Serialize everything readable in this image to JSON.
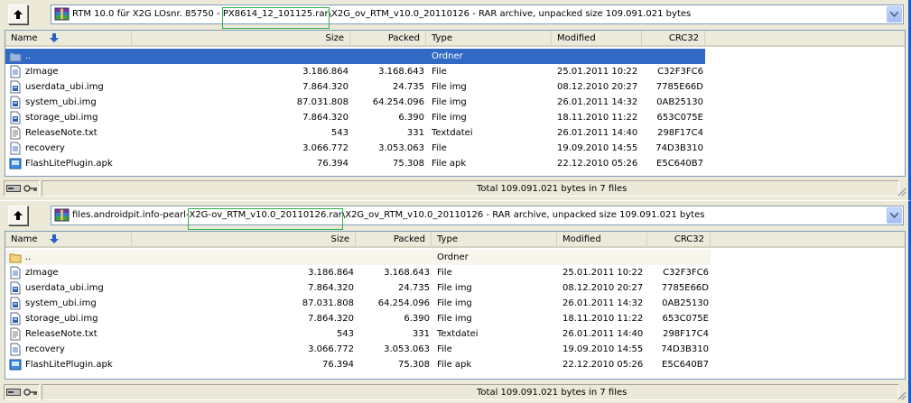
{
  "panes": [
    {
      "address": {
        "prefix": "RTM 10.0 für X2G LOsnr. 85750 - ",
        "highlight": "PX8614_12_101125.rar",
        "suffix": "\\X2G_ov_RTM_v10.0_20110126 - RAR archive, unpacked size 109.091.021 bytes"
      },
      "columns": {
        "name": "Name",
        "size": "Size",
        "packed": "Packed",
        "type": "Type",
        "modified": "Modified",
        "crc": "CRC32"
      },
      "parent": {
        "name": "..",
        "type": "Ordner"
      },
      "files": [
        {
          "name": "zImage",
          "size": "3.186.864",
          "packed": "3.168.643",
          "type": "File",
          "modified": "25.01.2011 10:22",
          "crc": "C32F3FC6",
          "icon": "generic-file-icon"
        },
        {
          "name": "userdata_ubi.img",
          "size": "7.864.320",
          "packed": "24.735",
          "type": "File img",
          "modified": "08.12.2010 20:27",
          "crc": "7785E66D",
          "icon": "image-file-icon"
        },
        {
          "name": "system_ubi.img",
          "size": "87.031.808",
          "packed": "64.254.096",
          "type": "File img",
          "modified": "26.01.2011 14:32",
          "crc": "0AB25130",
          "icon": "image-file-icon"
        },
        {
          "name": "storage_ubi.img",
          "size": "7.864.320",
          "packed": "6.390",
          "type": "File img",
          "modified": "18.11.2010 11:22",
          "crc": "653C075E",
          "icon": "image-file-icon"
        },
        {
          "name": "ReleaseNote.txt",
          "size": "543",
          "packed": "331",
          "type": "Textdatei",
          "modified": "26.01.2011 14:40",
          "crc": "298F17C4",
          "icon": "text-file-icon"
        },
        {
          "name": "recovery",
          "size": "3.066.772",
          "packed": "3.053.063",
          "type": "File",
          "modified": "19.09.2010 14:55",
          "crc": "74D3B310",
          "icon": "generic-file-icon"
        },
        {
          "name": "FlashLitePlugin.apk",
          "size": "76.394",
          "packed": "75.308",
          "type": "File apk",
          "modified": "22.12.2010 05:26",
          "crc": "E5C640B7",
          "icon": "apk-file-icon"
        }
      ],
      "status": "Total 109.091.021 bytes in 7 files"
    },
    {
      "address": {
        "prefix": "files.androidpit.info-pearl-",
        "highlight": "X2G-ov_RTM_v10.0_20110126.rar",
        "suffix": "\\X2G_ov_RTM_v10.0_20110126 - RAR archive, unpacked size 109.091.021 bytes"
      },
      "columns": {
        "name": "Name",
        "size": "Size",
        "packed": "Packed",
        "type": "Type",
        "modified": "Modified",
        "crc": "CRC32"
      },
      "parent": {
        "name": "..",
        "type": "Ordner"
      },
      "files": [
        {
          "name": "zImage",
          "size": "3.186.864",
          "packed": "3.168.643",
          "type": "File",
          "modified": "25.01.2011 10:22",
          "crc": "C32F3FC6",
          "icon": "generic-file-icon"
        },
        {
          "name": "userdata_ubi.img",
          "size": "7.864.320",
          "packed": "24.735",
          "type": "File img",
          "modified": "08.12.2010 20:27",
          "crc": "7785E66D",
          "icon": "image-file-icon"
        },
        {
          "name": "system_ubi.img",
          "size": "87.031.808",
          "packed": "64.254.096",
          "type": "File img",
          "modified": "26.01.2011 14:32",
          "crc": "0AB25130",
          "icon": "image-file-icon"
        },
        {
          "name": "storage_ubi.img",
          "size": "7.864.320",
          "packed": "6.390",
          "type": "File img",
          "modified": "18.11.2010 11:22",
          "crc": "653C075E",
          "icon": "image-file-icon"
        },
        {
          "name": "ReleaseNote.txt",
          "size": "543",
          "packed": "331",
          "type": "Textdatei",
          "modified": "26.01.2011 14:40",
          "crc": "298F17C4",
          "icon": "text-file-icon"
        },
        {
          "name": "recovery",
          "size": "3.066.772",
          "packed": "3.053.063",
          "type": "File",
          "modified": "19.09.2010 14:55",
          "crc": "74D3B310",
          "icon": "generic-file-icon"
        },
        {
          "name": "FlashLitePlugin.apk",
          "size": "76.394",
          "packed": "75.308",
          "type": "File apk",
          "modified": "22.12.2010 05:26",
          "crc": "E5C640B7",
          "icon": "apk-file-icon"
        }
      ],
      "status": "Total 109.091.021 bytes in 7 files"
    }
  ],
  "colors": {
    "selection": "#316ac5",
    "highlight_box": "#2db34a",
    "window_border": "#1d59c9"
  }
}
